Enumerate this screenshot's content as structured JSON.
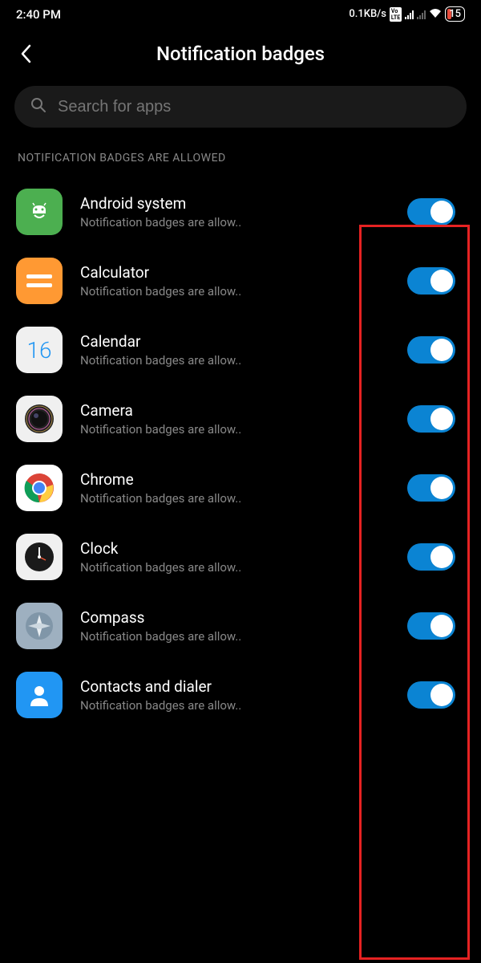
{
  "status": {
    "time": "2:40 PM",
    "speed": "0.1KB/s",
    "battery": "15"
  },
  "header": {
    "title": "Notification badges"
  },
  "search": {
    "placeholder": "Search for apps"
  },
  "section": {
    "label": "NOTIFICATION BADGES ARE ALLOWED"
  },
  "apps": [
    {
      "name": "Android system",
      "sub": "Notification badges are allow..",
      "enabled": true,
      "icon": "android"
    },
    {
      "name": "Calculator",
      "sub": "Notification badges are allow..",
      "enabled": true,
      "icon": "calculator"
    },
    {
      "name": "Calendar",
      "sub": "Notification badges are allow..",
      "enabled": true,
      "icon": "calendar"
    },
    {
      "name": "Camera",
      "sub": "Notification badges are allow..",
      "enabled": true,
      "icon": "camera"
    },
    {
      "name": "Chrome",
      "sub": "Notification badges are allow..",
      "enabled": true,
      "icon": "chrome"
    },
    {
      "name": "Clock",
      "sub": "Notification badges are allow..",
      "enabled": true,
      "icon": "clock"
    },
    {
      "name": "Compass",
      "sub": "Notification badges are allow..",
      "enabled": true,
      "icon": "compass"
    },
    {
      "name": "Contacts and dialer",
      "sub": "Notification badges are allow..",
      "enabled": true,
      "icon": "contacts"
    }
  ],
  "calendar_day": "16"
}
